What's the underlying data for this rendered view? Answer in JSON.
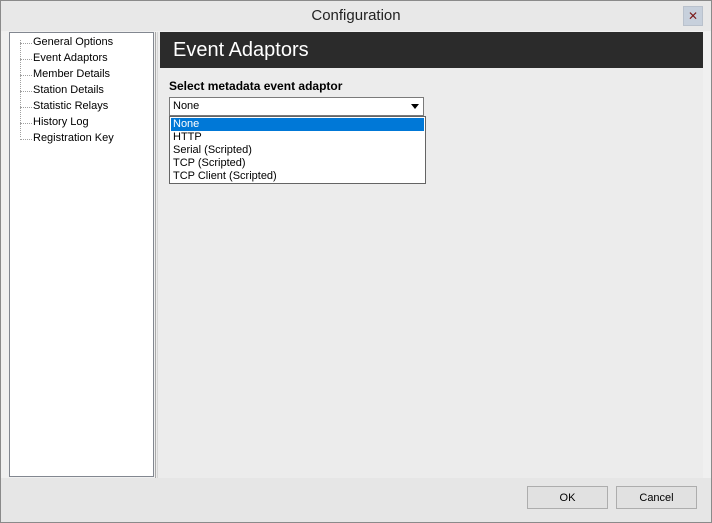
{
  "window": {
    "title": "Configuration"
  },
  "sidebar": {
    "items": [
      {
        "label": "General Options"
      },
      {
        "label": "Event Adaptors"
      },
      {
        "label": "Member Details"
      },
      {
        "label": "Station Details"
      },
      {
        "label": "Statistic Relays"
      },
      {
        "label": "History Log"
      },
      {
        "label": "Registration Key"
      }
    ]
  },
  "panel": {
    "title": "Event Adaptors",
    "field_label": "Select metadata event adaptor",
    "selected_value": "None",
    "options": [
      {
        "label": "None",
        "selected": true
      },
      {
        "label": "HTTP",
        "selected": false
      },
      {
        "label": "Serial (Scripted)",
        "selected": false
      },
      {
        "label": "TCP (Scripted)",
        "selected": false
      },
      {
        "label": "TCP Client (Scripted)",
        "selected": false
      }
    ]
  },
  "buttons": {
    "ok": "OK",
    "cancel": "Cancel"
  },
  "colors": {
    "selection": "#0078d7",
    "header": "#2b2b2b",
    "close_glyph": "#7a1a1a"
  },
  "icons": {
    "close": "close-icon",
    "dropdown": "chevron-down-icon"
  }
}
